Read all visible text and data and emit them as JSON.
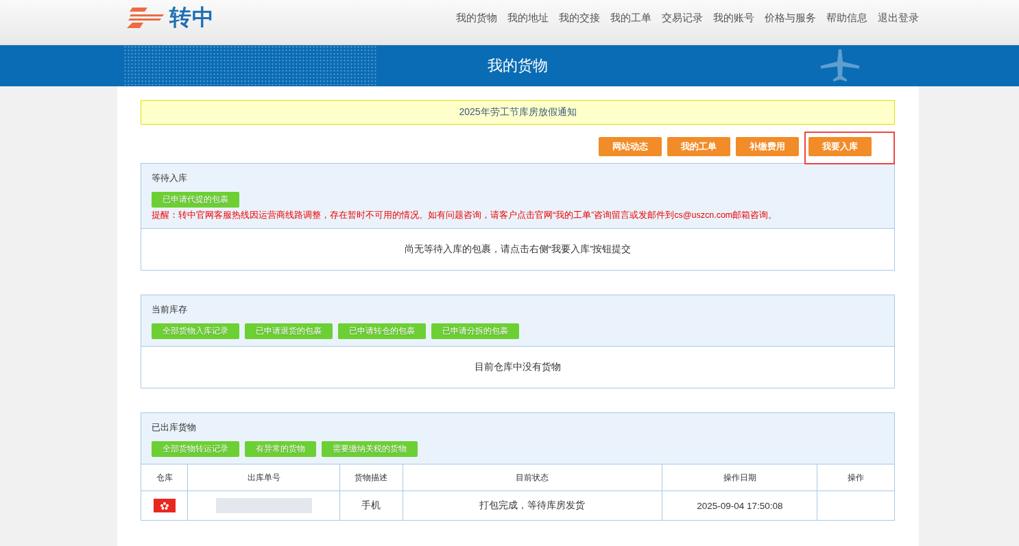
{
  "logo": {
    "text": "转中"
  },
  "nav": [
    {
      "label": "我的货物"
    },
    {
      "label": "我的地址"
    },
    {
      "label": "我的交接"
    },
    {
      "label": "我的工单"
    },
    {
      "label": "交易记录"
    },
    {
      "label": "我的账号"
    },
    {
      "label": "价格与服务"
    },
    {
      "label": "帮助信息"
    },
    {
      "label": "退出登录"
    }
  ],
  "banner": {
    "title": "我的货物"
  },
  "notice": "2025年劳工节库房放假通知",
  "actions": [
    {
      "label": "网站动态",
      "highlighted": false
    },
    {
      "label": "我的工单",
      "highlighted": false
    },
    {
      "label": "补缴费用",
      "highlighted": false
    },
    {
      "label": "我要入库",
      "highlighted": true
    }
  ],
  "sections": [
    {
      "kind": "empty",
      "title": "等待入库",
      "buttons": [
        "已申请代提的包裹"
      ],
      "reminder": "提醒：转中官网客服热线因运营商线路调整，存在暂时不可用的情况。如有问题咨询，请客户点击官网“我的工单”咨询留言或发邮件到cs@uszcn.com邮箱咨询。",
      "empty_message": "尚无等待入库的包裹，请点击右侧“我要入库”按钮提交"
    },
    {
      "kind": "empty",
      "title": "当前库存",
      "buttons": [
        "全部货物入库记录",
        "已申请退货的包裹",
        "已申请转仓的包裹",
        "已申请分拆的包裹"
      ],
      "empty_message": "目前仓库中没有货物"
    },
    {
      "kind": "table",
      "title": "已出库货物",
      "buttons": [
        "全部货物转运记录",
        "有异常的货物",
        "需要缴纳关税的货物"
      ],
      "table": {
        "columns": [
          "仓库",
          "出库单号",
          "货物描述",
          "目前状态",
          "操作日期",
          "操作"
        ],
        "rows": [
          {
            "description": "手机",
            "status": "打包完成，等待库房发货",
            "date": "2025-09-04 17:50:08"
          }
        ]
      }
    }
  ]
}
